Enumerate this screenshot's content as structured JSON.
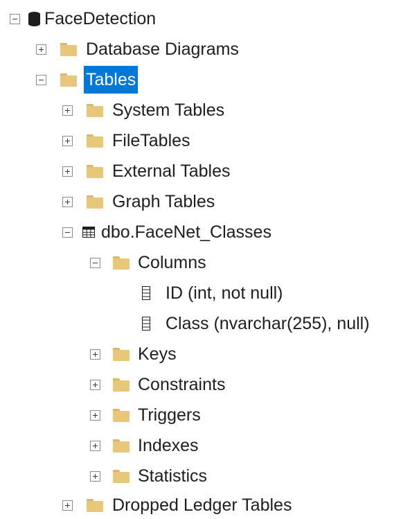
{
  "tree": {
    "root": {
      "label": "FaceDetection",
      "icon": "database-icon",
      "expanded": true
    },
    "database_diagrams": {
      "label": "Database Diagrams",
      "icon": "folder-icon",
      "expanded": false
    },
    "tables": {
      "label": "Tables",
      "icon": "folder-icon",
      "expanded": true,
      "selected": true
    },
    "system_tables": {
      "label": "System Tables",
      "icon": "folder-icon",
      "expanded": false
    },
    "filetables": {
      "label": "FileTables",
      "icon": "folder-icon",
      "expanded": false
    },
    "external_tables": {
      "label": "External Tables",
      "icon": "folder-icon",
      "expanded": false
    },
    "graph_tables": {
      "label": "Graph Tables",
      "icon": "folder-icon",
      "expanded": false
    },
    "facenet_table": {
      "label": "dbo.FaceNet_Classes",
      "icon": "table-icon",
      "expanded": true
    },
    "columns": {
      "label": "Columns",
      "icon": "folder-icon",
      "expanded": true
    },
    "column_id": {
      "label": "ID (int, not null)",
      "icon": "column-icon"
    },
    "column_class": {
      "label": "Class (nvarchar(255), null)",
      "icon": "column-icon"
    },
    "keys": {
      "label": "Keys",
      "icon": "folder-icon",
      "expanded": false
    },
    "constraints": {
      "label": "Constraints",
      "icon": "folder-icon",
      "expanded": false
    },
    "triggers": {
      "label": "Triggers",
      "icon": "folder-icon",
      "expanded": false
    },
    "indexes": {
      "label": "Indexes",
      "icon": "folder-icon",
      "expanded": false
    },
    "statistics": {
      "label": "Statistics",
      "icon": "folder-icon",
      "expanded": false
    },
    "dropped_ledger_tables": {
      "label": "Dropped Ledger Tables",
      "icon": "folder-icon",
      "expanded": false
    }
  },
  "colors": {
    "selection": "#0078d7",
    "folder": "#e8c77a",
    "text": "#1e1e1e"
  }
}
